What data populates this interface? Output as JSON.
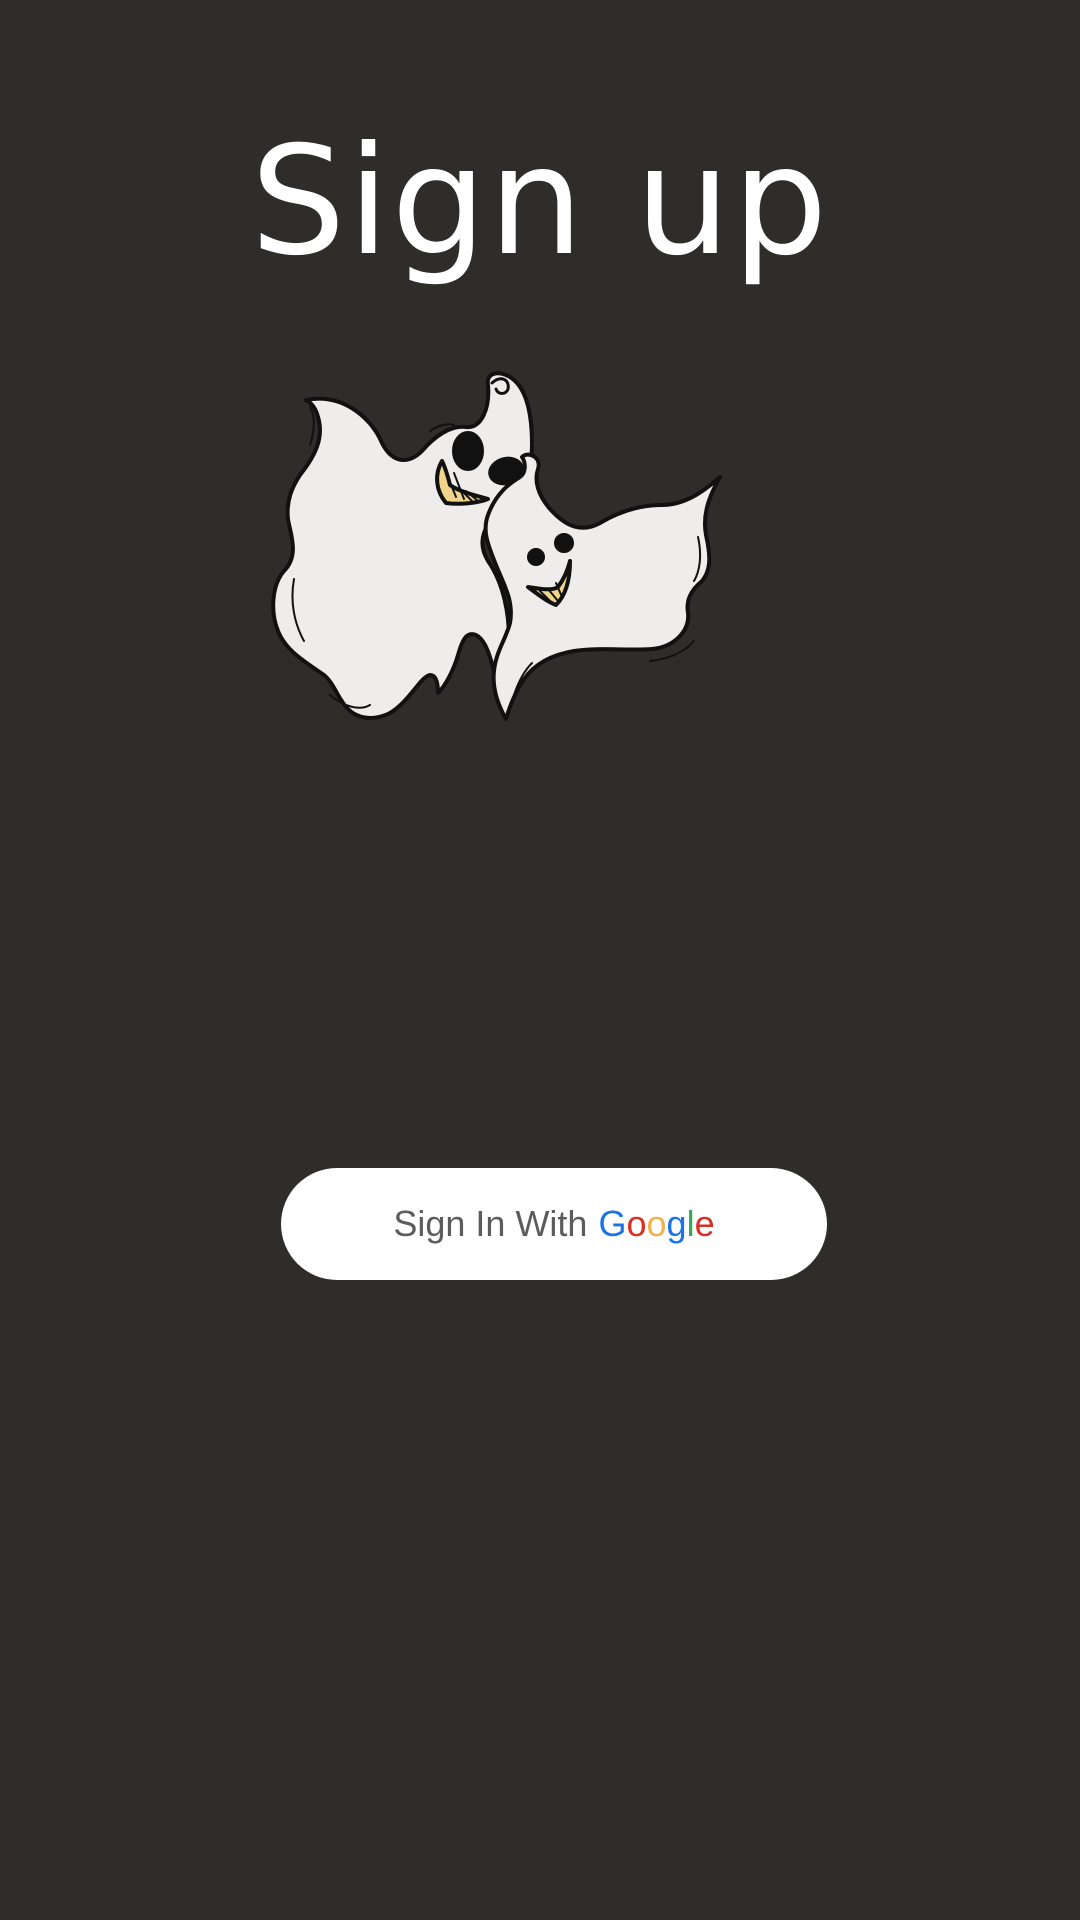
{
  "page": {
    "title": "Sign up"
  },
  "illustration": {
    "icon": "ghosts-illustration"
  },
  "google_button": {
    "prefix": "Sign In With",
    "brand_letters": [
      {
        "char": "G",
        "color": "#1a73e8"
      },
      {
        "char": "o",
        "color": "#d93025"
      },
      {
        "char": "o",
        "color": "#f2b24b"
      },
      {
        "char": "g",
        "color": "#1a73e8"
      },
      {
        "char": "l",
        "color": "#34a853"
      },
      {
        "char": "e",
        "color": "#d93025"
      }
    ]
  },
  "colors": {
    "background": "#2e2d2a",
    "title": "#ffffff",
    "button_background": "#ffffff",
    "button_text": "#5c5c5c",
    "ghost_body": "#eeedeb",
    "ghost_mouth": "#f0d48a"
  }
}
